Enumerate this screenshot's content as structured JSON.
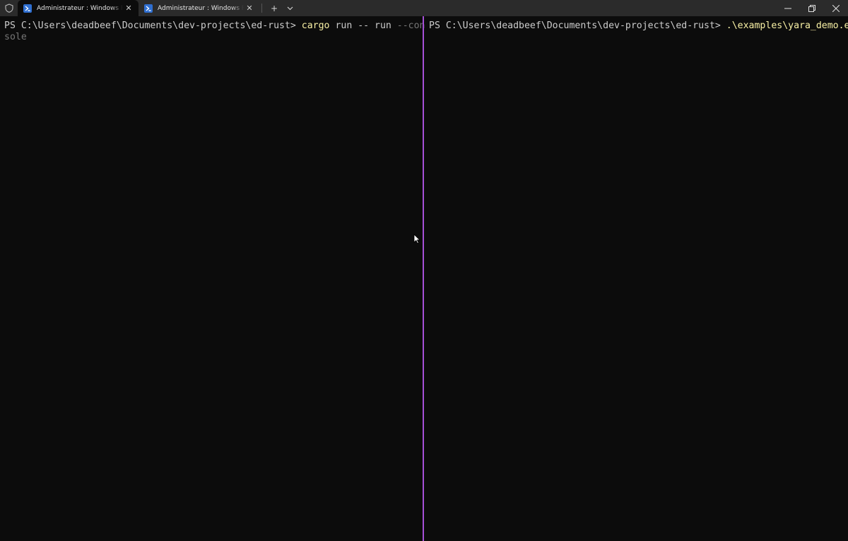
{
  "tabs": [
    {
      "title": "Administrateur : Windows PowerShell",
      "active": true
    },
    {
      "title": "Administrateur : Windows PowerShell",
      "active": false
    }
  ],
  "toolbar": {
    "new_tab": "+",
    "dropdown": "⌄",
    "close_tab": "✕"
  },
  "window_controls": {
    "minimize": "—",
    "restore": "❐",
    "close": "✕"
  },
  "left_pane": {
    "prompt": "PS C:\\Users\\deadbeef\\Documents\\dev-projects\\ed-rust> ",
    "command": "cargo",
    "args": " run -- run ",
    "flag_part1": "--con",
    "flag_part2": "sole"
  },
  "right_pane": {
    "prompt": "PS C:\\Users\\deadbeef\\Documents\\dev-projects\\ed-rust> ",
    "command": ".\\examples\\yara_demo.exe"
  },
  "colors": {
    "background": "#0c0c0c",
    "titlebar": "#2b2b2b",
    "divider": "#a650d8",
    "command": "#f9f1a5",
    "text": "#cccccc",
    "flag": "#767676"
  }
}
